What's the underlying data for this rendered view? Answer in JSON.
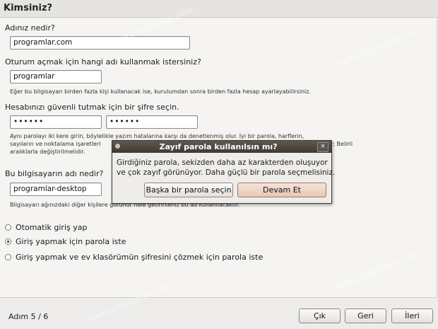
{
  "header": {
    "title": "Kimsiniz?"
  },
  "form": {
    "name_label": "Adınız nedir?",
    "name_value": "programlar.com",
    "login_label": "Oturum açmak için hangi adı kullanmak istersiniz?",
    "login_value": "programlar",
    "login_hint": "Eğer bu bilgisayarı birden fazla kişi kullanacak ise, kurulumdan sonra birden fazla hesap ayarlayabilirsiniz.",
    "password_label": "Hesabınızı güvenli tutmak için bir şifre seçin.",
    "password_value": "••••••",
    "password_confirm_value": "••••••",
    "password_hint_line1": "Aynı parolayı iki kere girin, böylelikle yazım hatalarına karşı da denetlenmiş olur. İyi bir parola, harflerin,",
    "password_hint_line2": "sayıların ve noktalama işaretleri",
    "password_hint_line2_tail": "r; Belirli",
    "password_hint_line3": "aralıklarla değiştirilmelidir.",
    "computer_label": "Bu bilgisayarın adı nedir?",
    "computer_value": "programlar-desktop",
    "computer_hint": "Bilgisayarı ağınızdaki diğer kişilere görünür hale getirirseniz bu ad kullanılacaktır."
  },
  "login_options": [
    {
      "label": "Otomatik giriş yap",
      "checked": false
    },
    {
      "label": "Giriş yapmak için parola iste",
      "checked": true
    },
    {
      "label": "Giriş yapmak ve ev klasörümün şifresini çözmek için parola iste",
      "checked": false
    }
  ],
  "footer": {
    "step": "Adım 5 / 6",
    "quit_label": "Çık",
    "back_label": "Geri",
    "forward_label": "İleri"
  },
  "dialog": {
    "title": "Zayıf parola kullanılsın mı?",
    "close_symbol": "×",
    "message_line1": "Girdiğiniz parola, sekizden daha az karakterden oluşuyor",
    "message_line2": "ve çok zayıf görünüyor. Daha güçlü bir parola seçmelisiniz.",
    "other_button": "Başka bir parola seçin",
    "continue_button": "Devam Et"
  },
  "watermark": "www.programlar.com",
  "colors": {
    "background": "#edeceb",
    "dialog_titlebar": "#4a443d",
    "default_button": "#e6c8b6"
  }
}
